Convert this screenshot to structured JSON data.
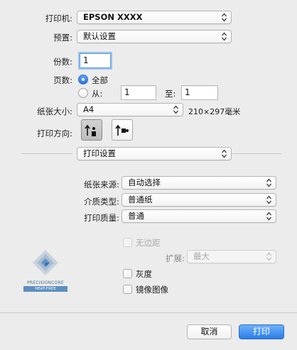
{
  "printer": {
    "label": "打印机:",
    "value": "EPSON XXXX"
  },
  "preset": {
    "label": "预置:",
    "value": "默认设置"
  },
  "copies": {
    "label": "份数:",
    "value": "1"
  },
  "pages": {
    "label": "页数:",
    "all_label": "全部",
    "all_selected": true,
    "from_label": "从:",
    "from_value": "1",
    "to_label": "至:",
    "to_value": "1"
  },
  "paper_size": {
    "label": "纸张大小:",
    "value": "A4",
    "dimensions": "210×297毫米"
  },
  "orientation": {
    "label": "打印方向:",
    "selected": "portrait"
  },
  "section_popup": {
    "value": "打印设置"
  },
  "paper_source": {
    "label": "纸张来源:",
    "value": "自动选择"
  },
  "media_type": {
    "label": "介质类型:",
    "value": "普通纸"
  },
  "print_quality": {
    "label": "打印质量:",
    "value": "普通"
  },
  "borderless": {
    "label": "无边距",
    "checked": false,
    "enabled": false
  },
  "expansion": {
    "label": "扩展:",
    "value": "最大",
    "enabled": false
  },
  "grayscale": {
    "label": "灰度",
    "checked": false
  },
  "mirror": {
    "label": "镜像图像",
    "checked": false
  },
  "logo": {
    "line1": "PRECISIONCORE",
    "line2": "HEAT-FREE"
  },
  "buttons": {
    "cancel": "取消",
    "print": "打印"
  },
  "colors": {
    "accent": "#2a7de6",
    "focus_ring": "#9cc3ee"
  }
}
